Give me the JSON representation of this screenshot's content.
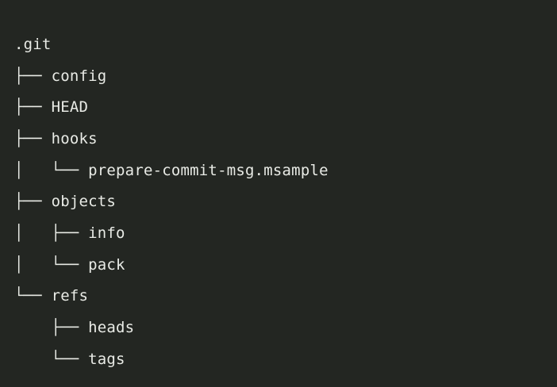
{
  "colors": {
    "background": "#232622",
    "text": "#e9ebe6"
  },
  "tree": {
    "root": ".git",
    "lines": [
      {
        "prefix": "├── ",
        "name": "config"
      },
      {
        "prefix": "├── ",
        "name": "HEAD"
      },
      {
        "prefix": "├── ",
        "name": "hooks"
      },
      {
        "prefix": "│   └── ",
        "name": "prepare-commit-msg.msample"
      },
      {
        "prefix": "├── ",
        "name": "objects"
      },
      {
        "prefix": "│   ├── ",
        "name": "info"
      },
      {
        "prefix": "│   └── ",
        "name": "pack"
      },
      {
        "prefix": "└── ",
        "name": "refs"
      },
      {
        "prefix": "    ├── ",
        "name": "heads"
      },
      {
        "prefix": "    └── ",
        "name": "tags"
      }
    ]
  }
}
